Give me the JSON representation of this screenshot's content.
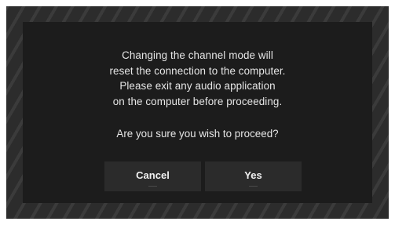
{
  "dialog": {
    "message_lines": [
      "Changing the channel mode will",
      "reset the connection to the computer.",
      "Please exit any audio application",
      "on the computer before proceeding."
    ],
    "question": "Are you sure you wish to proceed?",
    "cancel_label": "Cancel",
    "yes_label": "Yes"
  }
}
